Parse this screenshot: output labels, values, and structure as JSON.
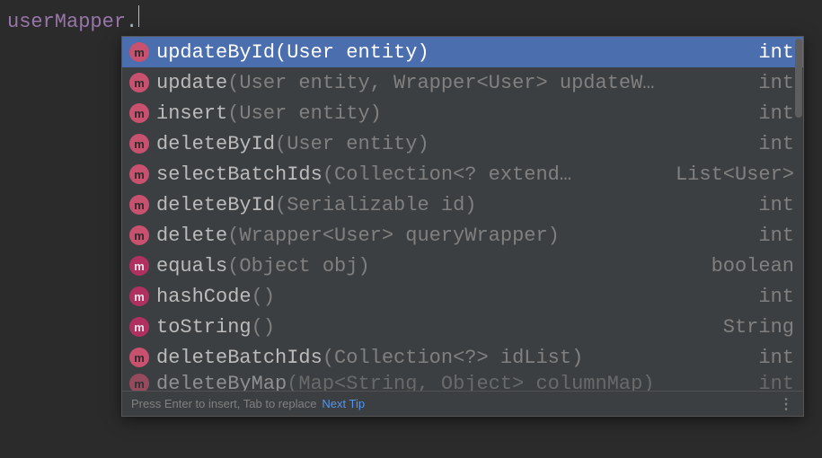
{
  "code": {
    "identifier": "userMapper",
    "dot": "."
  },
  "suggestions": [
    {
      "icon": "pink",
      "name": "updateById",
      "params": "(User entity)",
      "ret": "int",
      "selected": true
    },
    {
      "icon": "pink",
      "name": "update",
      "params": "(User entity, Wrapper<User> updateW…",
      "ret": "int"
    },
    {
      "icon": "pink",
      "name": "insert",
      "params": "(User entity)",
      "ret": "int"
    },
    {
      "icon": "pink",
      "name": "deleteById",
      "params": "(User entity)",
      "ret": "int"
    },
    {
      "icon": "pink",
      "name": "selectBatchIds",
      "params": "(Collection<? extend…",
      "ret": "List<User>"
    },
    {
      "icon": "pink",
      "name": "deleteById",
      "params": "(Serializable id)",
      "ret": "int"
    },
    {
      "icon": "pink",
      "name": "delete",
      "params": "(Wrapper<User> queryWrapper)",
      "ret": "int"
    },
    {
      "icon": "magenta",
      "name": "equals",
      "params": "(Object obj)",
      "ret": "boolean"
    },
    {
      "icon": "magenta",
      "name": "hashCode",
      "params": "()",
      "ret": "int"
    },
    {
      "icon": "magenta",
      "name": "toString",
      "params": "()",
      "ret": "String"
    },
    {
      "icon": "pink",
      "name": "deleteBatchIds",
      "params": "(Collection<?> idList)",
      "ret": "int"
    }
  ],
  "partial": {
    "icon": "pink",
    "name": "deleteByMap",
    "params": "(Map<String, Object> columnMap)",
    "ret": "int"
  },
  "footer": {
    "hint": "Press Enter to insert, Tab to replace",
    "link": "Next Tip",
    "more": "⋮"
  }
}
